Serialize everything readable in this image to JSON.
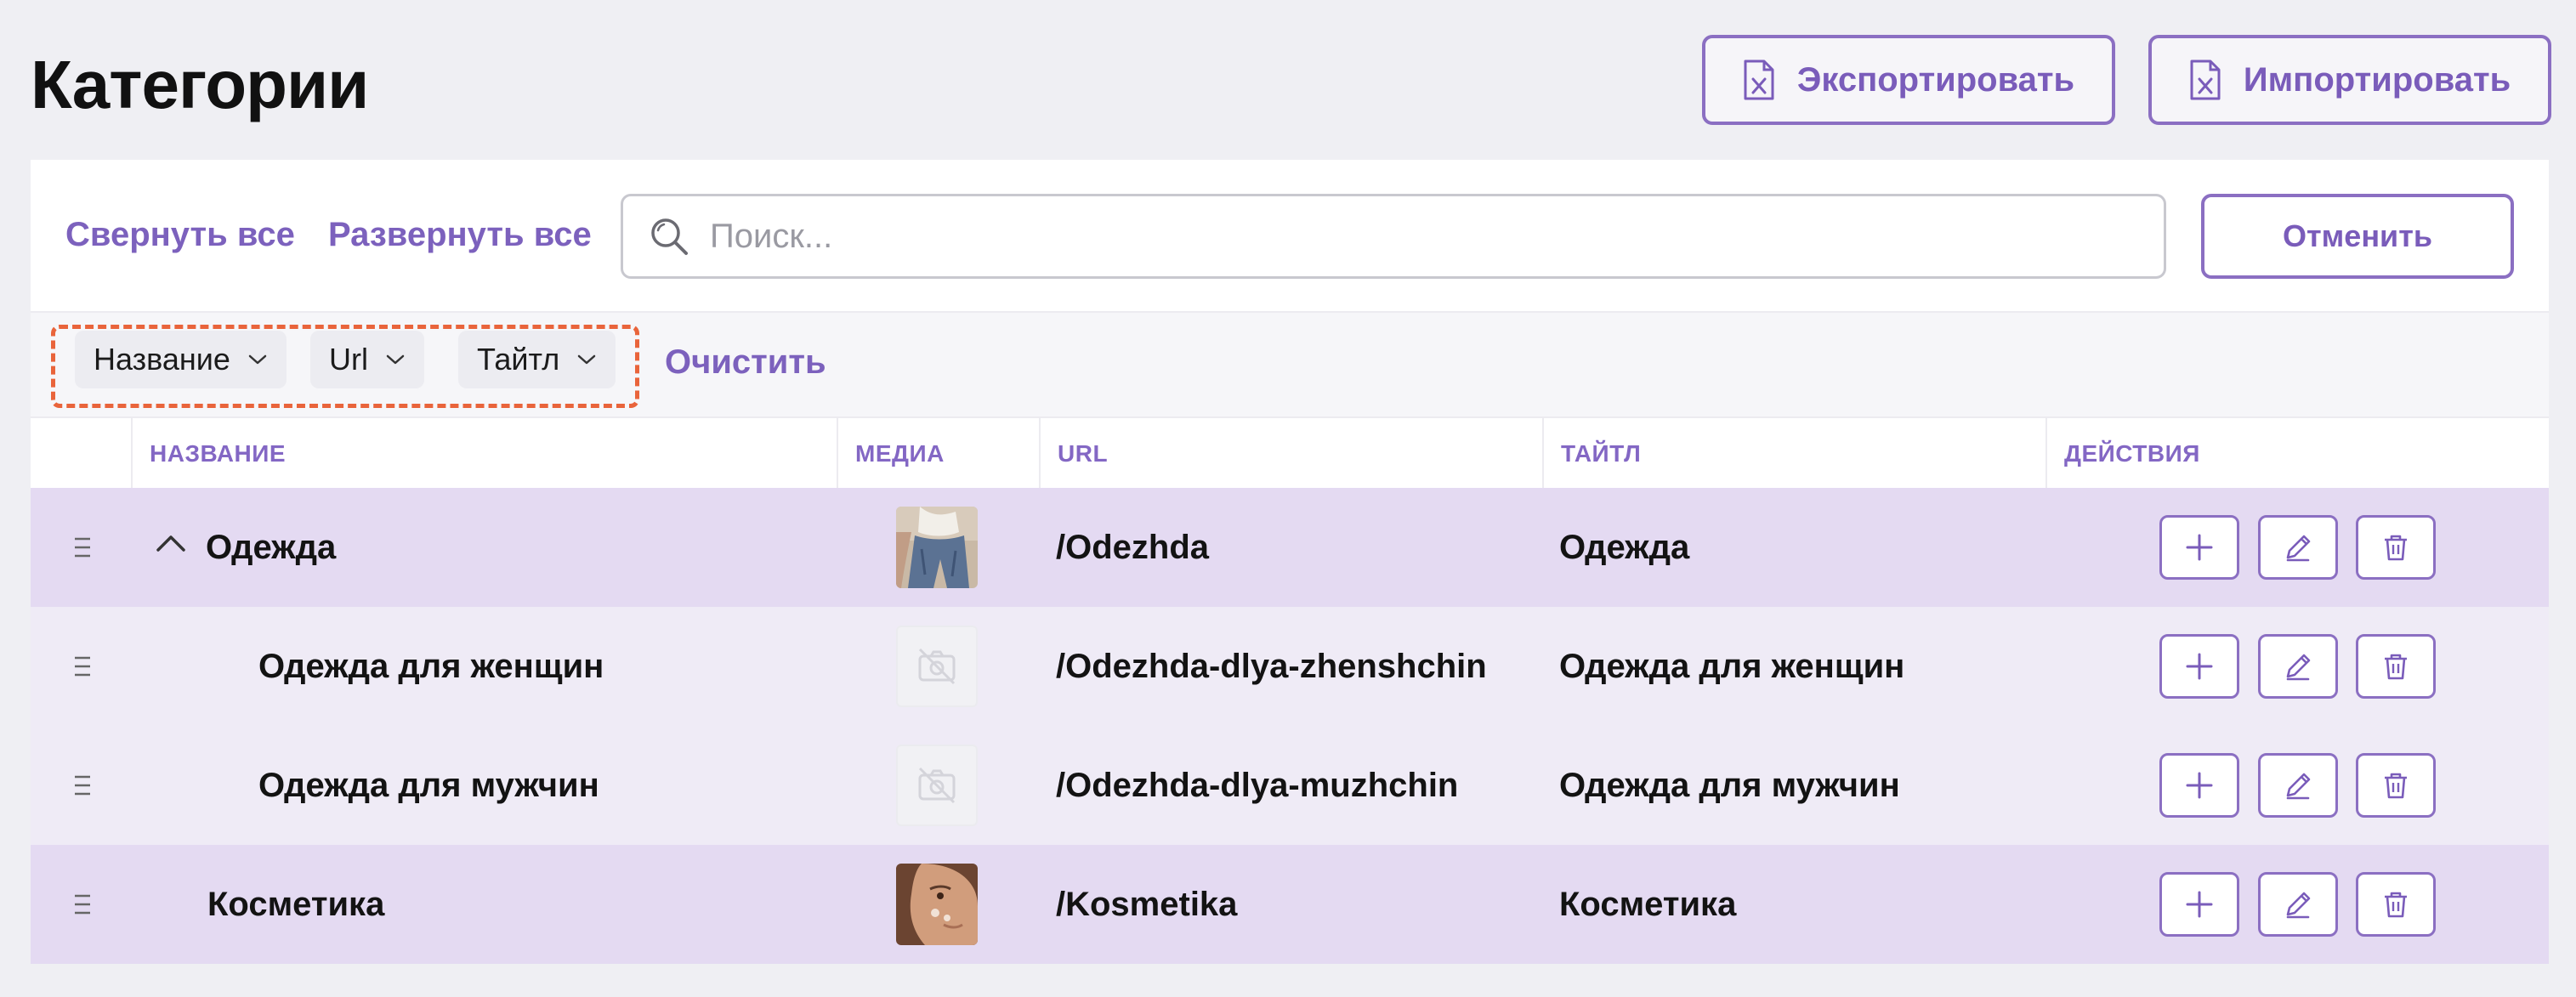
{
  "header": {
    "title": "Категории",
    "export_label": "Экспортировать",
    "import_label": "Импортировать"
  },
  "toolbar": {
    "collapse_all": "Свернуть все",
    "expand_all": "Развернуть все",
    "search_placeholder": "Поиск...",
    "cancel_label": "Отменить"
  },
  "filters": {
    "chips": [
      "Название",
      "Url",
      "Тайтл"
    ],
    "clear_label": "Очистить"
  },
  "table": {
    "columns": [
      "НАЗВАНИЕ",
      "МЕДИА",
      "URL",
      "ТАЙТЛ",
      "ДЕЙСТВИЯ"
    ],
    "rows": [
      {
        "name": "Одежда",
        "url": "/Odezhda",
        "title": "Одежда",
        "media": "photo-jeans",
        "level": 0,
        "expanded": true
      },
      {
        "name": "Одежда для женщин",
        "url": "/Odezhda-dlya-zhenshchin",
        "title": "Одежда для женщин",
        "media": "no-image",
        "level": 1
      },
      {
        "name": "Одежда для мужчин",
        "url": "/Odezhda-dlya-muzhchin",
        "title": "Одежда для мужчин",
        "media": "no-image",
        "level": 1
      },
      {
        "name": "Косметика",
        "url": "/Kosmetika",
        "title": "Косметика",
        "media": "photo-face",
        "level": 0
      }
    ]
  },
  "colors": {
    "accent": "#7a5cba",
    "parent_row": "#e4daf2",
    "child_row": "#efebf6",
    "highlight_dash": "#e9643b"
  },
  "icons": {
    "export": "excel-file-icon",
    "import": "excel-file-icon",
    "search": "magnifier-icon",
    "row_handle": "drag-handle-icon",
    "expand": "chevron-up-icon",
    "add": "plus-icon",
    "edit": "pencil-icon",
    "delete": "trash-icon"
  }
}
